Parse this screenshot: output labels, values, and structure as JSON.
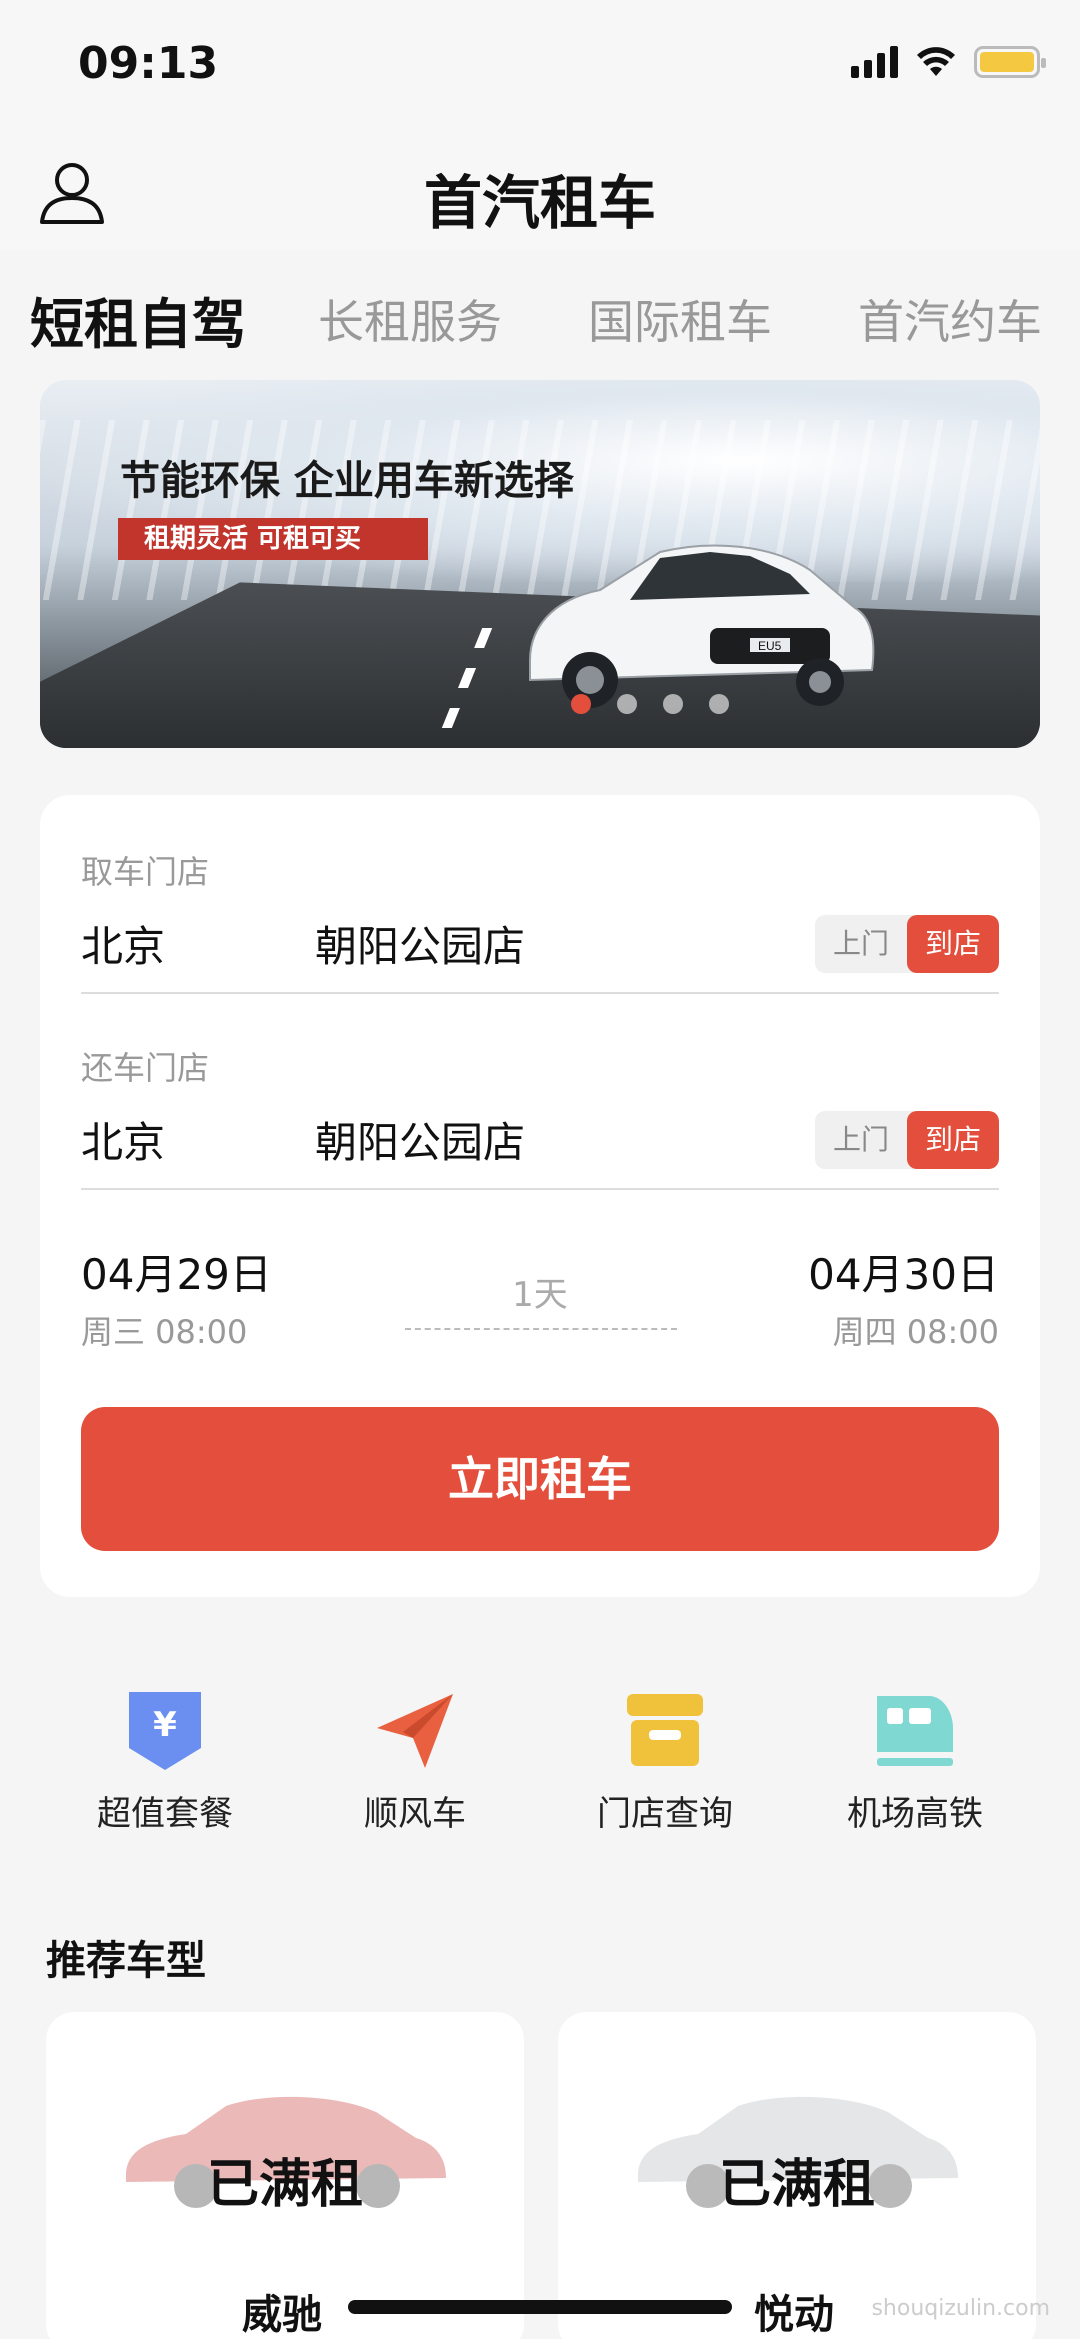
{
  "status": {
    "time": "09:13"
  },
  "header": {
    "title": "首汽租车"
  },
  "tabs": [
    {
      "label": "短租自驾",
      "active": true
    },
    {
      "label": "长租服务",
      "active": false
    },
    {
      "label": "国际租车",
      "active": false
    },
    {
      "label": "首汽约车",
      "active": false
    }
  ],
  "banner": {
    "title": "节能环保  企业用车新选择",
    "tag": "租期灵活    可租可买",
    "car_badge": "EU5",
    "slides": 4,
    "active_slide": 1
  },
  "booking": {
    "pickup": {
      "label": "取车门店",
      "city": "北京",
      "store": "朝阳公园店",
      "toggle": {
        "off": "上门",
        "on": "到店"
      }
    },
    "return": {
      "label": "还车门店",
      "city": "北京",
      "store": "朝阳公园店",
      "toggle": {
        "off": "上门",
        "on": "到店"
      }
    },
    "start": {
      "date": "04月29日",
      "time": "周三 08:00"
    },
    "end": {
      "date": "04月30日",
      "time": "周四 08:00"
    },
    "duration": "1天",
    "button": "立即租车"
  },
  "quick_actions": [
    {
      "label": "超值套餐",
      "icon": "coupon-icon",
      "color": "#6b8ff0"
    },
    {
      "label": "顺风车",
      "icon": "paper-plane-icon",
      "color": "#e8603f"
    },
    {
      "label": "门店查询",
      "icon": "store-icon",
      "color": "#f0c13a"
    },
    {
      "label": "机场高铁",
      "icon": "train-icon",
      "color": "#7fd9d2"
    }
  ],
  "recommend": {
    "title": "推荐车型",
    "cars": [
      {
        "status": "已满租",
        "name": "威驰",
        "color": "#c93a3a"
      },
      {
        "status": "已满租",
        "name": "悦动",
        "color": "#bfc3c7"
      }
    ]
  },
  "watermark": "shouqizulin.com",
  "colors": {
    "accent": "#e34f3c"
  }
}
